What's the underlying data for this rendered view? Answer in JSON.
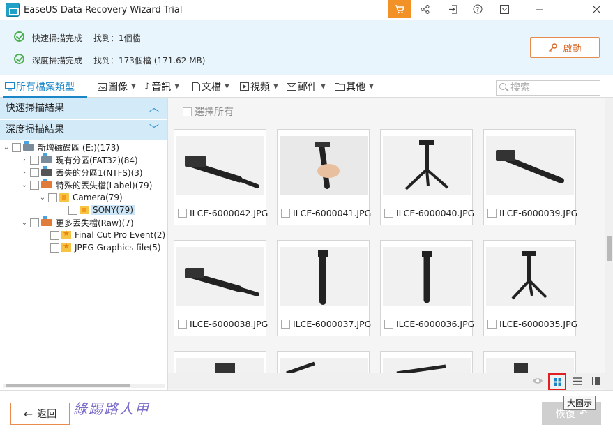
{
  "window": {
    "title": "EaseUS Data Recovery Wizard Trial"
  },
  "status": {
    "quick_label": "快速掃描完成",
    "quick_found": "找到：1個檔",
    "deep_label": "深度掃描完成",
    "deep_found": "找到：173個檔 (171.62 MB)",
    "start_button": "啟動"
  },
  "filters": {
    "all": "所有檔案類型",
    "image": "圖像",
    "audio": "音訊",
    "document": "文檔",
    "video": "視頻",
    "email": "郵件",
    "other": "其他",
    "search_placeholder": "搜索"
  },
  "sidebar": {
    "quick_results": "快速掃描結果",
    "deep_results": "深度掃描結果",
    "tree": [
      {
        "label": "新增磁碟區 (E:)(173)"
      },
      {
        "label": "現有分區(FAT32)(84)"
      },
      {
        "label": "丟失的分區1(NTFS)(3)"
      },
      {
        "label": "特殊的丟失檔(Label)(79)"
      },
      {
        "label": "Camera(79)"
      },
      {
        "label": "SONY(79)"
      },
      {
        "label": "更多丟失檔(Raw)(7)"
      },
      {
        "label": "Final Cut Pro Event(2)"
      },
      {
        "label": "JPEG Graphics file(5)"
      }
    ]
  },
  "main": {
    "select_all": "選擇所有",
    "files": [
      {
        "name": "ILCE-6000042.JPG"
      },
      {
        "name": "ILCE-6000041.JPG"
      },
      {
        "name": "ILCE-6000040.JPG"
      },
      {
        "name": "ILCE-6000039.JPG"
      },
      {
        "name": "ILCE-6000038.JPG"
      },
      {
        "name": "ILCE-6000037.JPG"
      },
      {
        "name": "ILCE-6000036.JPG"
      },
      {
        "name": "ILCE-6000035.JPG"
      }
    ]
  },
  "view": {
    "tooltip": "大圖示"
  },
  "bottom": {
    "back": "返回",
    "recover": "恢復",
    "watermark": "綠踢路人甲"
  },
  "colors": {
    "accent": "#1a86c8",
    "cart": "#f29125",
    "start_border": "#e88b4c",
    "highlight": "#e02020"
  }
}
